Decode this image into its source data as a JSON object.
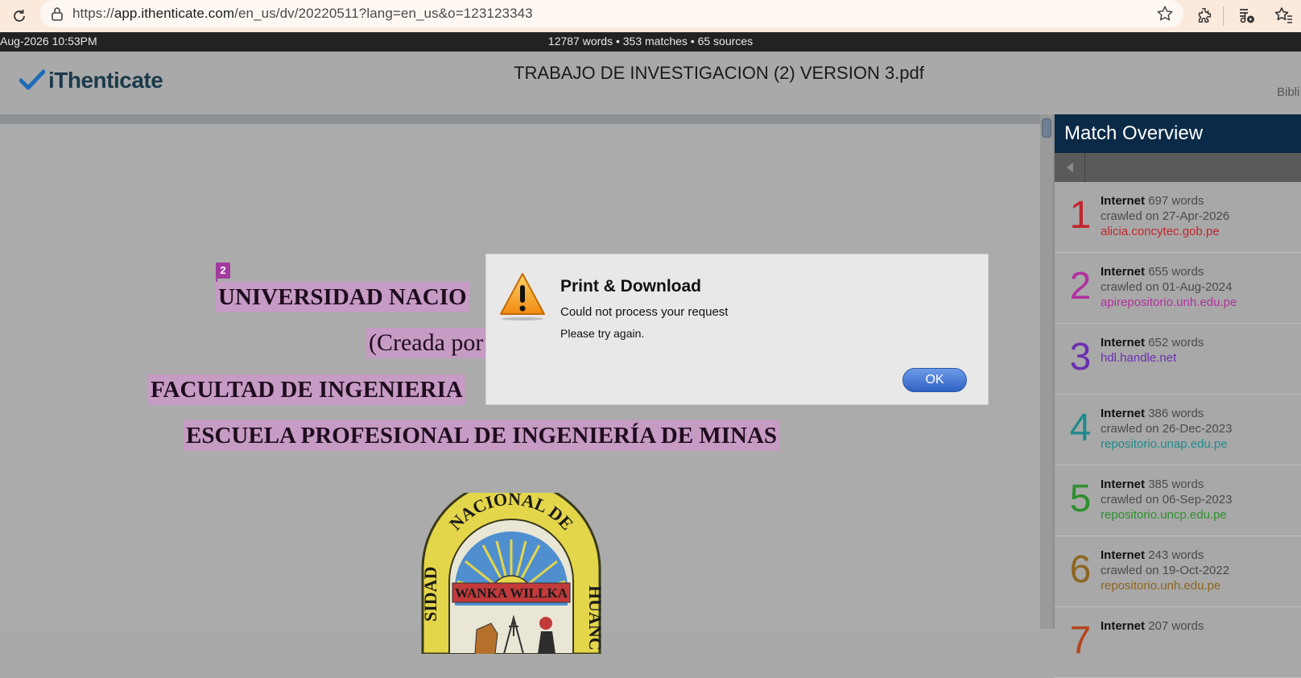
{
  "browser": {
    "url_scheme": "https://",
    "url_host": "app.ithenticate.com",
    "url_path": "/en_us/dv/20220511?lang=en_us&o=123123343",
    "icons": [
      "reload-icon",
      "lock-icon",
      "star-icon",
      "extensions-icon",
      "media-icon",
      "favorites-icon"
    ]
  },
  "statusbar": {
    "datetime": "Aug-2026 10:53PM",
    "summary": "12787 words • 353 matches • 65 sources"
  },
  "header": {
    "logo_text": "iThenticate",
    "doc_title": "TRABAJO DE INVESTIGACION (2) VERSION 3.pdf",
    "biblio_label": "Bibli"
  },
  "document": {
    "match_tag": "2",
    "lines": [
      "UNIVERSIDAD NACIO",
      "(Creada por",
      "FACULTAD DE INGENIERIA",
      "ESCUELA PROFESIONAL DE INGENIERÍA DE MINAS"
    ],
    "seal_text": [
      "NACIONAL DE",
      "SIDAD",
      "HUANC",
      "WANKA WILLKA"
    ],
    "highlight_color": "#c69bc4"
  },
  "match_overview": {
    "title": "Match Overview",
    "items": [
      {
        "num": "1",
        "type": "Internet",
        "words": "697 words",
        "crawled": "crawled on 27-Apr-2026",
        "source": "alicia.concytec.gob.pe",
        "color": "#c0272d"
      },
      {
        "num": "2",
        "type": "Internet",
        "words": "655 words",
        "crawled": "crawled on 01-Aug-2024",
        "source": "apirepositorio.unh.edu.pe",
        "color": "#b0309f"
      },
      {
        "num": "3",
        "type": "Internet",
        "words": "652 words",
        "crawled": "",
        "source": "hdl.handle.net",
        "color": "#6a2fb0"
      },
      {
        "num": "4",
        "type": "Internet",
        "words": "386 words",
        "crawled": "crawled on 26-Dec-2023",
        "source": "repositorio.unap.edu.pe",
        "color": "#1f8a8c"
      },
      {
        "num": "5",
        "type": "Internet",
        "words": "385 words",
        "crawled": "crawled on 06-Sep-2023",
        "source": "repositorio.uncp.edu.pe",
        "color": "#2f8f2f"
      },
      {
        "num": "6",
        "type": "Internet",
        "words": "243 words",
        "crawled": "crawled on 19-Oct-2022",
        "source": "repositorio.unh.edu.pe",
        "color": "#8c6620"
      },
      {
        "num": "7",
        "type": "Internet",
        "words": "207 words",
        "crawled": "",
        "source": "",
        "color": "#b5441d"
      }
    ]
  },
  "modal": {
    "title": "Print & Download",
    "message": "Could not process your request",
    "submessage": "Please try again.",
    "ok_label": "OK"
  }
}
